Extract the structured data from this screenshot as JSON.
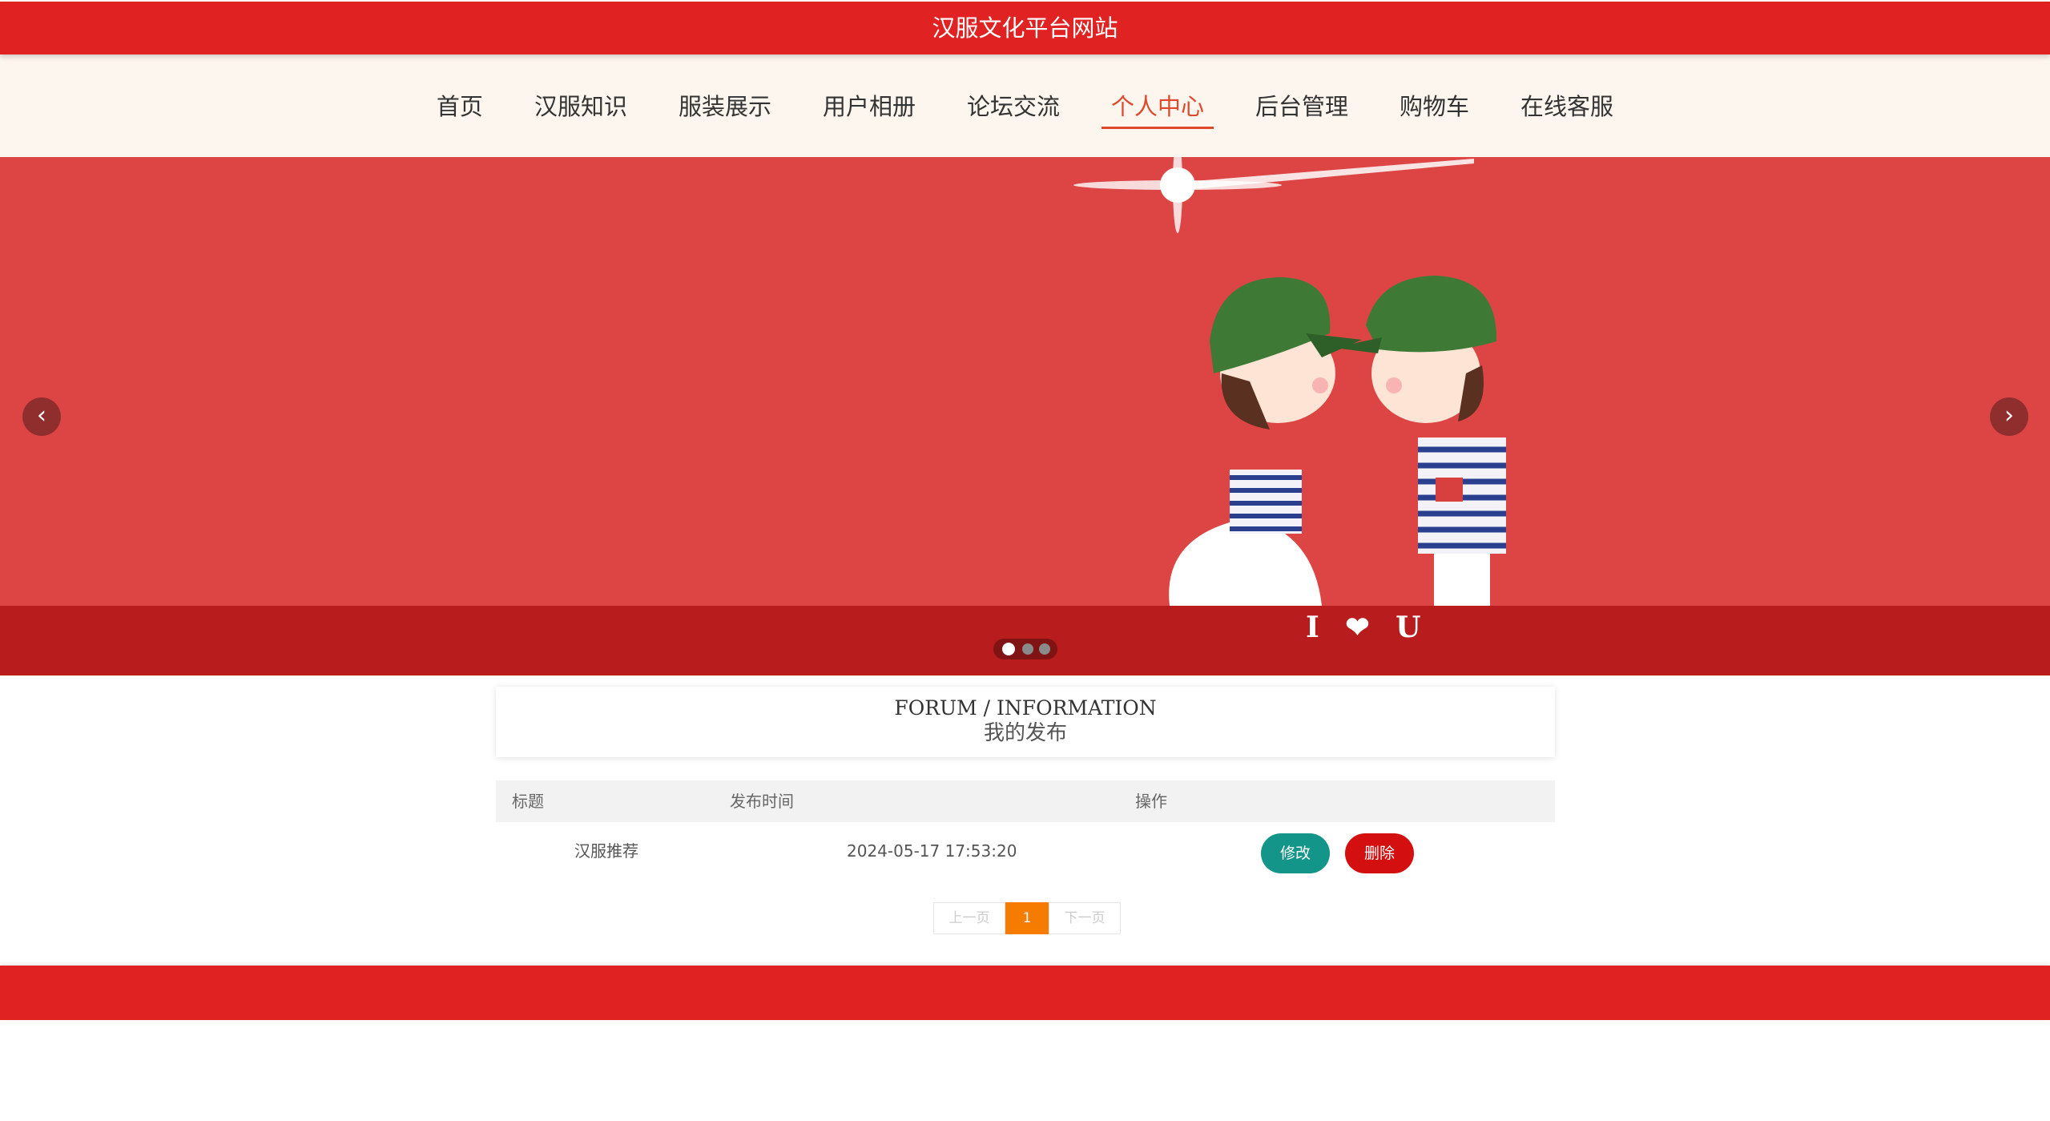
{
  "site": {
    "title": "汉服文化平台网站"
  },
  "nav": {
    "items": [
      {
        "label": "首页"
      },
      {
        "label": "汉服知识"
      },
      {
        "label": "服装展示"
      },
      {
        "label": "用户相册"
      },
      {
        "label": "论坛交流"
      },
      {
        "label": "个人中心"
      },
      {
        "label": "后台管理"
      },
      {
        "label": "购物车"
      },
      {
        "label": "在线客服"
      }
    ],
    "active_index": 5
  },
  "banner": {
    "caption_art": "I ❤ U",
    "prev_icon": "chevron-left-icon",
    "next_icon": "chevron-right-icon",
    "slide_count": 3,
    "active_slide": 0
  },
  "section": {
    "title_en": "FORUM / INFORMATION",
    "title_cn": "我的发布"
  },
  "table": {
    "columns": [
      "标题",
      "发布时间",
      "操作"
    ],
    "rows": [
      {
        "title": "汉服推荐",
        "time": "2024-05-17 17:53:20",
        "edit_label": "修改",
        "delete_label": "删除"
      }
    ]
  },
  "pagination": {
    "prev_label": "上一页",
    "current": "1",
    "next_label": "下一页"
  },
  "colors": {
    "brand_red": "#e02222",
    "active_nav": "#e0482b",
    "edit_button": "#139689",
    "delete_button": "#d40f0f",
    "current_page": "#f57c00"
  }
}
